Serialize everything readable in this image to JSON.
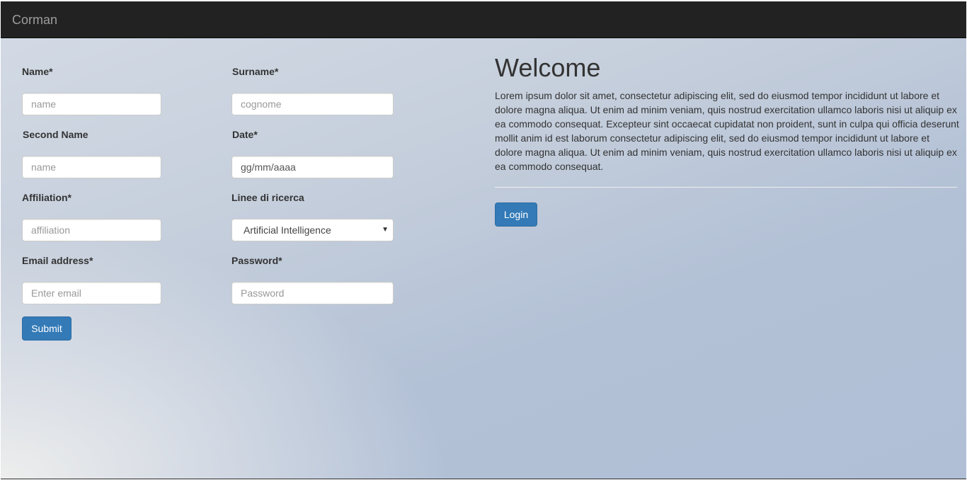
{
  "navbar": {
    "brand": "Corman"
  },
  "form": {
    "name": {
      "label": "Name*",
      "placeholder": "name"
    },
    "surname": {
      "label": "Surname*",
      "placeholder": "cognome"
    },
    "second_name": {
      "label": "Second Name",
      "placeholder": "name"
    },
    "date": {
      "label": "Date*",
      "value": "gg/mm/aaaa"
    },
    "affiliation": {
      "label": "Affiliation*",
      "placeholder": "affiliation"
    },
    "research_lines": {
      "label": "Linee di ricerca",
      "selected": "Artificial Intelligence"
    },
    "email": {
      "label": "Email address*",
      "placeholder": "Enter email"
    },
    "password": {
      "label": "Password*",
      "placeholder": "Password"
    },
    "submit_label": "Submit"
  },
  "welcome": {
    "title": "Welcome",
    "text": "Lorem ipsum dolor sit amet, consectetur adipiscing elit, sed do eiusmod tempor incididunt ut labore et dolore magna aliqua. Ut enim ad minim veniam, quis nostrud exercitation ullamco laboris nisi ut aliquip ex ea commodo consequat. Excepteur sint occaecat cupidatat non proident, sunt in culpa qui officia deserunt mollit anim id est laborum consectetur adipiscing elit, sed do eiusmod tempor incididunt ut labore et dolore magna aliqua. Ut enim ad minim veniam, quis nostrud exercitation ullamco laboris nisi ut aliquip ex ea commodo consequat.",
    "login_label": "Login"
  },
  "colors": {
    "navbar": "#222222",
    "primary": "#337ab7"
  },
  "icons": {
    "select_arrow": "caret-down-icon"
  }
}
